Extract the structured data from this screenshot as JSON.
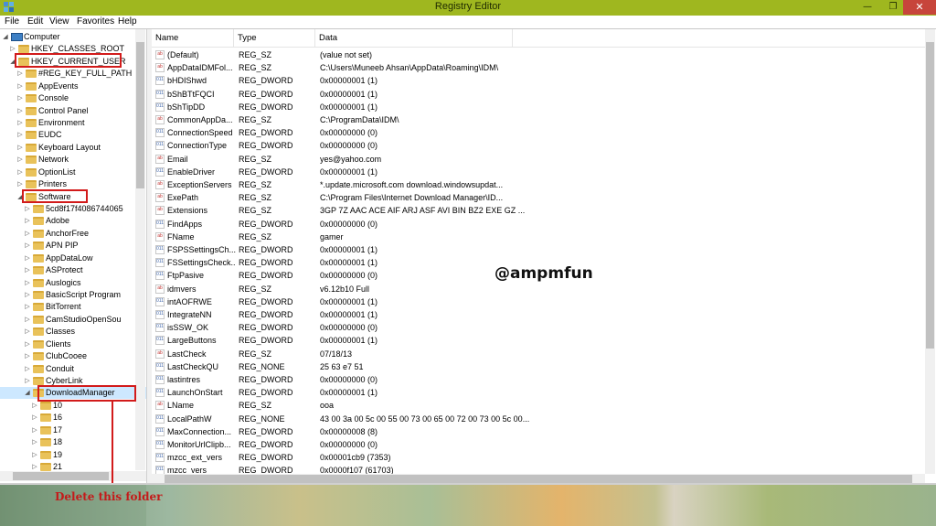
{
  "window": {
    "title": "Registry Editor",
    "colors": {
      "titlebar": "#9fb71f",
      "close": "#c7453b",
      "highlight": "#d21b1b",
      "selection": "#cde8ff"
    },
    "controls": {
      "minimize": "—",
      "restore": "❐",
      "close": "✕"
    }
  },
  "menu": [
    "File",
    "Edit",
    "View",
    "Favorites",
    "Help"
  ],
  "tree": {
    "items": [
      {
        "label": "Computer",
        "icon": "computer-icon",
        "expanded": true
      },
      {
        "label": "HKEY_CLASSES_ROOT",
        "expanded": false
      },
      {
        "label": "HKEY_CURRENT_USER",
        "expanded": true,
        "highlighted": true
      },
      {
        "label": "#REG_KEY_FULL_PATH"
      },
      {
        "label": "AppEvents"
      },
      {
        "label": "Console"
      },
      {
        "label": "Control Panel"
      },
      {
        "label": "Environment"
      },
      {
        "label": "EUDC"
      },
      {
        "label": "Keyboard Layout"
      },
      {
        "label": "Network"
      },
      {
        "label": "OptionList"
      },
      {
        "label": "Printers"
      },
      {
        "label": "Software",
        "expanded": true,
        "highlighted": true
      },
      {
        "label": "5cd8f17f4086744065"
      },
      {
        "label": "Adobe"
      },
      {
        "label": "AnchorFree"
      },
      {
        "label": "APN PIP"
      },
      {
        "label": "AppDataLow"
      },
      {
        "label": "ASProtect"
      },
      {
        "label": "Auslogics"
      },
      {
        "label": "BasicScript Program"
      },
      {
        "label": "BitTorrent"
      },
      {
        "label": "CamStudioOpenSou"
      },
      {
        "label": "Classes"
      },
      {
        "label": "Clients"
      },
      {
        "label": "ClubCooee"
      },
      {
        "label": "Conduit"
      },
      {
        "label": "CyberLink"
      },
      {
        "label": "DownloadManager",
        "expanded": true,
        "selected": true,
        "highlighted": true
      },
      {
        "label": "10"
      },
      {
        "label": "16"
      },
      {
        "label": "17"
      },
      {
        "label": "18"
      },
      {
        "label": "19"
      },
      {
        "label": "21"
      }
    ]
  },
  "list": {
    "columns": [
      "Name",
      "Type",
      "Data"
    ],
    "rows": [
      {
        "kind": "sz",
        "name": "(Default)",
        "type": "REG_SZ",
        "data": "(value not set)"
      },
      {
        "kind": "sz",
        "name": "AppDataIDMFol...",
        "type": "REG_SZ",
        "data": "C:\\Users\\Muneeb Ahsan\\AppData\\Roaming\\IDM\\"
      },
      {
        "kind": "bin",
        "name": "bHDIShwd",
        "type": "REG_DWORD",
        "data": "0x00000001 (1)"
      },
      {
        "kind": "bin",
        "name": "bShBTtFQCI",
        "type": "REG_DWORD",
        "data": "0x00000001 (1)"
      },
      {
        "kind": "bin",
        "name": "bShTipDD",
        "type": "REG_DWORD",
        "data": "0x00000001 (1)"
      },
      {
        "kind": "sz",
        "name": "CommonAppDa...",
        "type": "REG_SZ",
        "data": "C:\\ProgramData\\IDM\\"
      },
      {
        "kind": "bin",
        "name": "ConnectionSpeed",
        "type": "REG_DWORD",
        "data": "0x00000000 (0)"
      },
      {
        "kind": "bin",
        "name": "ConnectionType",
        "type": "REG_DWORD",
        "data": "0x00000000 (0)"
      },
      {
        "kind": "sz",
        "name": "Email",
        "type": "REG_SZ",
        "data": "yes@yahoo.com"
      },
      {
        "kind": "bin",
        "name": "EnableDriver",
        "type": "REG_DWORD",
        "data": "0x00000001 (1)"
      },
      {
        "kind": "sz",
        "name": "ExceptionServers",
        "type": "REG_SZ",
        "data": "*.update.microsoft.com download.windowsupdat..."
      },
      {
        "kind": "sz",
        "name": "ExePath",
        "type": "REG_SZ",
        "data": "C:\\Program Files\\Internet Download Manager\\ID..."
      },
      {
        "kind": "sz",
        "name": "Extensions",
        "type": "REG_SZ",
        "data": "3GP 7Z AAC ACE AIF ARJ ASF AVI BIN BZ2 EXE GZ ..."
      },
      {
        "kind": "bin",
        "name": "FindApps",
        "type": "REG_DWORD",
        "data": "0x00000000 (0)"
      },
      {
        "kind": "sz",
        "name": "FName",
        "type": "REG_SZ",
        "data": "gamer"
      },
      {
        "kind": "bin",
        "name": "FSPSSettingsCh...",
        "type": "REG_DWORD",
        "data": "0x00000001 (1)"
      },
      {
        "kind": "bin",
        "name": "FSSettingsCheck...",
        "type": "REG_DWORD",
        "data": "0x00000001 (1)"
      },
      {
        "kind": "bin",
        "name": "FtpPasive",
        "type": "REG_DWORD",
        "data": "0x00000000 (0)"
      },
      {
        "kind": "sz",
        "name": "idmvers",
        "type": "REG_SZ",
        "data": "v6.12b10 Full"
      },
      {
        "kind": "bin",
        "name": "intAOFRWE",
        "type": "REG_DWORD",
        "data": "0x00000001 (1)"
      },
      {
        "kind": "bin",
        "name": "IntegrateNN",
        "type": "REG_DWORD",
        "data": "0x00000001 (1)"
      },
      {
        "kind": "bin",
        "name": "isSSW_OK",
        "type": "REG_DWORD",
        "data": "0x00000000 (0)"
      },
      {
        "kind": "bin",
        "name": "LargeButtons",
        "type": "REG_DWORD",
        "data": "0x00000001 (1)"
      },
      {
        "kind": "sz",
        "name": "LastCheck",
        "type": "REG_SZ",
        "data": "07/18/13"
      },
      {
        "kind": "bin",
        "name": "LastCheckQU",
        "type": "REG_NONE",
        "data": "25 63 e7 51"
      },
      {
        "kind": "bin",
        "name": "lastintres",
        "type": "REG_DWORD",
        "data": "0x00000000 (0)"
      },
      {
        "kind": "bin",
        "name": "LaunchOnStart",
        "type": "REG_DWORD",
        "data": "0x00000001 (1)"
      },
      {
        "kind": "sz",
        "name": "LName",
        "type": "REG_SZ",
        "data": "ooa"
      },
      {
        "kind": "bin",
        "name": "LocalPathW",
        "type": "REG_NONE",
        "data": "43 00 3a 00 5c 00 55 00 73 00 65 00 72 00 73 00 5c 00..."
      },
      {
        "kind": "bin",
        "name": "MaxConnection...",
        "type": "REG_DWORD",
        "data": "0x00000008 (8)"
      },
      {
        "kind": "bin",
        "name": "MonitorUrlClipb...",
        "type": "REG_DWORD",
        "data": "0x00000000 (0)"
      },
      {
        "kind": "bin",
        "name": "mzcc_ext_vers",
        "type": "REG_DWORD",
        "data": "0x00001cb9 (7353)"
      },
      {
        "kind": "bin",
        "name": "mzcc_vers",
        "type": "REG_DWORD",
        "data": "0x0000f107 (61703)"
      }
    ]
  },
  "watermark": "@ampmfun",
  "annotation": "Delete this folder"
}
